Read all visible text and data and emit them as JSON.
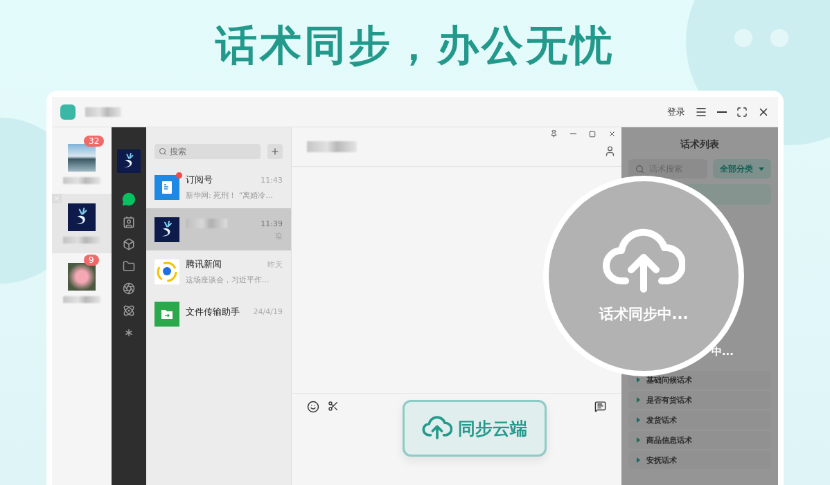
{
  "headline": "话术同步，办公无忧",
  "titlebar": {
    "login": "登录"
  },
  "accounts": [
    {
      "kind": "landscape",
      "badge": "32",
      "selected": false
    },
    {
      "kind": "logo",
      "selected": true
    },
    {
      "kind": "flower",
      "badge": "9",
      "selected": false
    }
  ],
  "nav": [
    {
      "kind": "avatar",
      "selected": false
    },
    {
      "kind": "chat",
      "selected": true
    },
    {
      "kind": "contacts",
      "selected": false
    },
    {
      "kind": "cube",
      "selected": false
    },
    {
      "kind": "folder",
      "selected": false
    },
    {
      "kind": "aperture",
      "selected": false
    },
    {
      "kind": "atom",
      "selected": false
    },
    {
      "kind": "sparkle",
      "selected": false
    }
  ],
  "chat_search": {
    "placeholder": "搜索"
  },
  "chats": [
    {
      "kind": "subscription",
      "name": "订阅号",
      "time": "11:43",
      "preview": "新华网: 死刑！ “离婚冷...",
      "unread": true,
      "muted": false,
      "selected": false
    },
    {
      "kind": "logo",
      "time": "11:39",
      "unread": false,
      "muted": true,
      "selected": true
    },
    {
      "kind": "news",
      "name": "腾讯新闻",
      "time": "昨天",
      "preview": "这场座谈会，习近平作...",
      "unread": false,
      "muted": false,
      "selected": false
    },
    {
      "kind": "transfer",
      "name": "文件传输助手",
      "time": "24/4/19",
      "unread": false,
      "muted": false,
      "selected": false
    }
  ],
  "script_panel": {
    "title": "话术列表",
    "search_placeholder": "话术搜索",
    "category": "全部分类",
    "peek_text": "中...",
    "categories": [
      "基础问候话术",
      "是否有货话术",
      "发货话术",
      "商品信息话术",
      "安抚话术"
    ]
  },
  "sync_overlay": {
    "label": "话术同步中..."
  },
  "sync_button": {
    "label": "同步云端"
  }
}
